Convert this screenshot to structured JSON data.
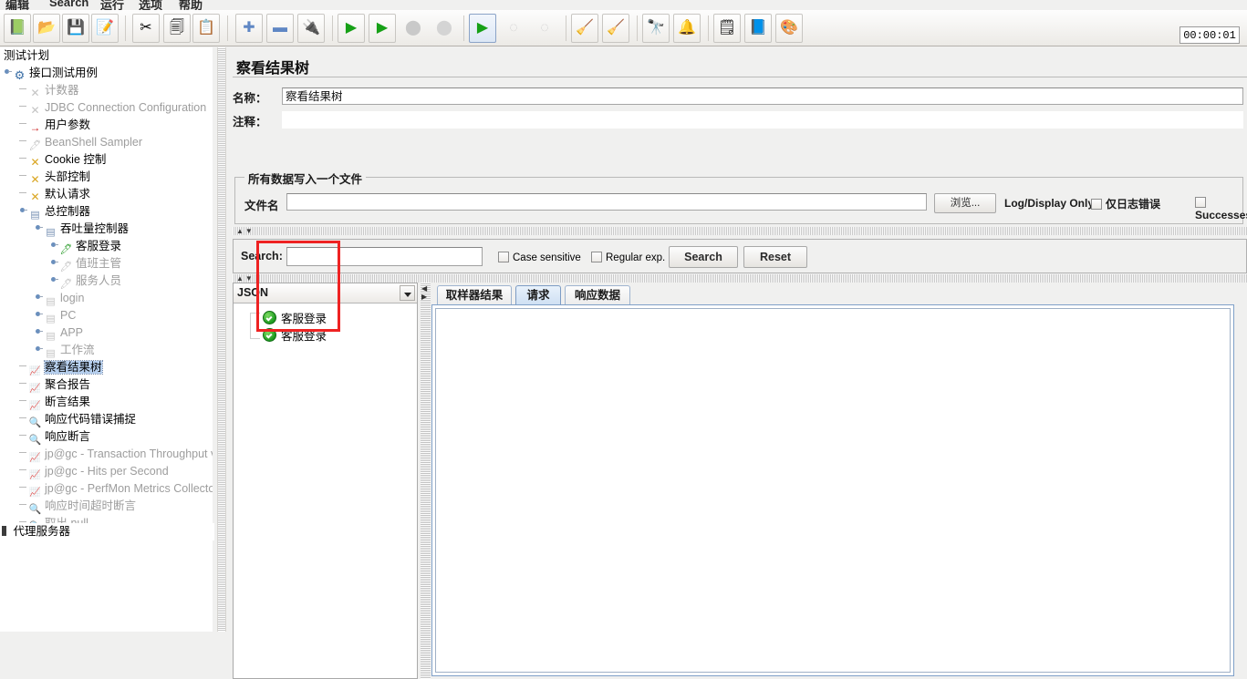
{
  "menu": {
    "items": [
      "编辑",
      "Search",
      "运行",
      "选项",
      "帮助"
    ]
  },
  "toolbar": {
    "timer": "00:00:01",
    "buttons": [
      {
        "name": "new-test-plan",
        "icon": "📗"
      },
      {
        "name": "open-file",
        "icon": "📂"
      },
      {
        "name": "save-file",
        "icon": "💾"
      },
      {
        "name": "save-as-file",
        "icon": "📝"
      },
      {
        "name": "cut",
        "icon": "✂"
      },
      {
        "name": "copy",
        "icon": "📄"
      },
      {
        "name": "paste",
        "icon": "📋"
      },
      {
        "name": "expand-all",
        "icon": "✚"
      },
      {
        "name": "collapse-all",
        "icon": "▬"
      },
      {
        "name": "toggle",
        "icon": "🔌"
      },
      {
        "name": "start",
        "icon": "▶"
      },
      {
        "name": "start-no-pause",
        "icon": "▶"
      },
      {
        "name": "stop",
        "icon": "⬤"
      },
      {
        "name": "shutdown",
        "icon": "⬤"
      },
      {
        "name": "start-remote-all",
        "icon": "▶"
      },
      {
        "name": "stop-remote-all",
        "icon": "◌"
      },
      {
        "name": "shutdown-remote-all",
        "icon": "◌"
      },
      {
        "name": "clear",
        "icon": "🧹"
      },
      {
        "name": "clear-all",
        "icon": "🧹"
      },
      {
        "name": "search-tree",
        "icon": "🔭"
      },
      {
        "name": "reset-search-tree",
        "icon": "🔔"
      },
      {
        "name": "function-helper",
        "icon": "📋"
      },
      {
        "name": "help",
        "icon": "📘"
      },
      {
        "name": "templates",
        "icon": "🎨"
      }
    ]
  },
  "tree": {
    "root": "测试计划",
    "bottom_item": "代理服务器",
    "selected": "察看结果树",
    "nodes": [
      {
        "label": "接口测试用例",
        "indent": 0,
        "icon": "gear-icon",
        "enabled": true,
        "knob": true
      },
      {
        "label": "计数器",
        "indent": 1,
        "icon": "config-element-icon",
        "enabled": false,
        "knob": false
      },
      {
        "label": "JDBC Connection Configuration",
        "indent": 1,
        "icon": "config-element-icon",
        "enabled": false,
        "knob": false
      },
      {
        "label": "用户参数",
        "indent": 1,
        "icon": "preprocessor-icon",
        "enabled": true,
        "knob": false
      },
      {
        "label": "BeanShell Sampler",
        "indent": 1,
        "icon": "sampler-icon",
        "enabled": false,
        "knob": false
      },
      {
        "label": "Cookie 控制",
        "indent": 1,
        "icon": "config-element-icon",
        "enabled": true,
        "knob": false
      },
      {
        "label": "头部控制",
        "indent": 1,
        "icon": "config-element-icon",
        "enabled": true,
        "knob": false
      },
      {
        "label": "默认请求",
        "indent": 1,
        "icon": "config-element-icon",
        "enabled": true,
        "knob": false
      },
      {
        "label": "总控制器",
        "indent": 1,
        "icon": "controller-icon",
        "enabled": true,
        "knob": true
      },
      {
        "label": "吞吐量控制器",
        "indent": 2,
        "icon": "controller-icon",
        "enabled": true,
        "knob": true
      },
      {
        "label": "客服登录",
        "indent": 3,
        "icon": "sampler-icon",
        "enabled": true,
        "knob": true
      },
      {
        "label": "值班主管",
        "indent": 3,
        "icon": "sampler-icon",
        "enabled": false,
        "knob": true
      },
      {
        "label": "服务人员",
        "indent": 3,
        "icon": "sampler-icon",
        "enabled": false,
        "knob": true
      },
      {
        "label": "login",
        "indent": 2,
        "icon": "controller-icon",
        "enabled": false,
        "knob": true
      },
      {
        "label": "PC",
        "indent": 2,
        "icon": "controller-icon",
        "enabled": false,
        "knob": true
      },
      {
        "label": "APP",
        "indent": 2,
        "icon": "controller-icon",
        "enabled": false,
        "knob": true
      },
      {
        "label": "工作流",
        "indent": 2,
        "icon": "controller-icon",
        "enabled": false,
        "knob": true
      },
      {
        "label": "察看结果树",
        "indent": 1,
        "icon": "listener-icon",
        "enabled": true,
        "knob": false
      },
      {
        "label": "聚合报告",
        "indent": 1,
        "icon": "listener-icon",
        "enabled": true,
        "knob": false
      },
      {
        "label": "断言结果",
        "indent": 1,
        "icon": "listener-icon",
        "enabled": true,
        "knob": false
      },
      {
        "label": "响应代码错误捕捉",
        "indent": 1,
        "icon": "assertion-icon",
        "enabled": true,
        "knob": false
      },
      {
        "label": "响应断言",
        "indent": 1,
        "icon": "assertion-icon",
        "enabled": true,
        "knob": false
      },
      {
        "label": "jp@gc - Transaction Throughput vs",
        "indent": 1,
        "icon": "listener-icon",
        "enabled": false,
        "knob": false
      },
      {
        "label": "jp@gc - Hits per Second",
        "indent": 1,
        "icon": "listener-icon",
        "enabled": false,
        "knob": false
      },
      {
        "label": "jp@gc - PerfMon Metrics Collector",
        "indent": 1,
        "icon": "listener-icon",
        "enabled": false,
        "knob": false
      },
      {
        "label": "响应时间超时断言",
        "indent": 1,
        "icon": "assertion-icon",
        "enabled": false,
        "knob": false
      },
      {
        "label": "取出 null",
        "indent": 1,
        "icon": "assertion-icon",
        "enabled": false,
        "knob": false
      }
    ]
  },
  "panel": {
    "title": "察看结果树",
    "name_label": "名称：",
    "name_value": "察看结果树",
    "comment_label": "注释：",
    "comment_value": "",
    "group_title": "所有数据写入一个文件",
    "filename_label": "文件名",
    "filename_value": "",
    "browse_button": "浏览...",
    "log_display_only_label": "Log/Display Only:",
    "errors_checkbox": "仅日志错误",
    "successes_checkbox": "Successes"
  },
  "search": {
    "label": "Search:",
    "value": "",
    "case_sensitive": "Case sensitive",
    "regular_exp": "Regular exp.",
    "search_button": "Search",
    "reset_button": "Reset"
  },
  "results": {
    "render_selected": "JSON",
    "items": [
      {
        "label": "客服登录",
        "status": "success"
      },
      {
        "label": "客服登录",
        "status": "success"
      }
    ]
  },
  "tabs": [
    {
      "label": "取样器结果",
      "active": false
    },
    {
      "label": "请求",
      "active": true
    },
    {
      "label": "响应数据",
      "active": false
    }
  ]
}
